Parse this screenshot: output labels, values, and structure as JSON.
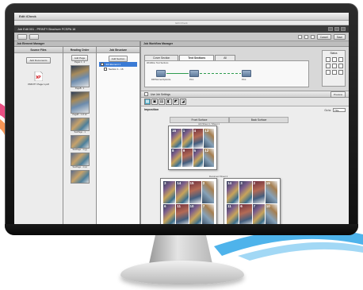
{
  "colors": {
    "swoosh_left": "#e52f6c",
    "swoosh_right": "#2fa6e8",
    "bezel": "#111111",
    "accent": "#3a7bd5",
    "workflow_line": "#2f9d4f"
  },
  "titlebar": {
    "title": "Edit iCheck"
  },
  "menubar": {
    "label": "Edit iCheck"
  },
  "app_header": {
    "title": "Job Edit 001 - PRINTY Brochure FCSPA 16"
  },
  "toolbar": {
    "btn_undo": "undo-icon",
    "btn_redo": "redo-icon",
    "cancel_label": "Cancel",
    "save_label": "Save"
  },
  "left_panel": {
    "title": "Job Element Manager",
    "source_files": {
      "header": "Source Files",
      "add_button": "Add Documents",
      "file_name": "PRINTY Page 1.pdf"
    },
    "reading_order": {
      "header": "Reading Order",
      "add_button": "Add Page",
      "item_captions": [
        "Pages 1 - 2",
        "PageB - 1",
        "PageB - 1 of 12",
        "TestPage - 1",
        "TestPage - 1 (g)",
        "TestPage - 1 (a)",
        "TestPage - 1 (b)"
      ]
    },
    "job_structure": {
      "header": "Job Structure",
      "add_button": "Add Section",
      "tree": [
        "Job Element 1",
        "Section 1 - 16"
      ]
    }
  },
  "right_panel": {
    "title": "Job Workflow Manager",
    "tabs": [
      "Cover Section",
      "Text Sections",
      "All"
    ],
    "active_tab": "Text Sections",
    "workflow_label": "Workflow: Text Sections",
    "nodes": [
      {
        "label": "RIP/Normal Optimize"
      },
      {
        "label": "Print"
      },
      {
        "label": "Print"
      }
    ],
    "status_title": "Status",
    "settings": {
      "label": "Use Job Settings",
      "preview_button": "Preview"
    },
    "imposition": {
      "title": "Imposition",
      "go_to_label": "Go to:",
      "go_to_value": "Title",
      "front_surface": "Front Surface",
      "back_surface": "Back Surface",
      "sheet1_caption": "Job Sheet 1 / Sheet 1",
      "sheet2_caption": "Document Sheet 2",
      "sheet1_pages": [
        "16",
        "1",
        "4",
        "13",
        "8",
        "9",
        "5",
        "12"
      ],
      "sheet2a_pages": [
        "3",
        "14",
        "15",
        "2",
        "6",
        "11",
        "10",
        "7"
      ],
      "sheet2b_pages": [
        "14",
        "3",
        "2",
        "15",
        "11",
        "6",
        "7",
        "10"
      ]
    }
  }
}
